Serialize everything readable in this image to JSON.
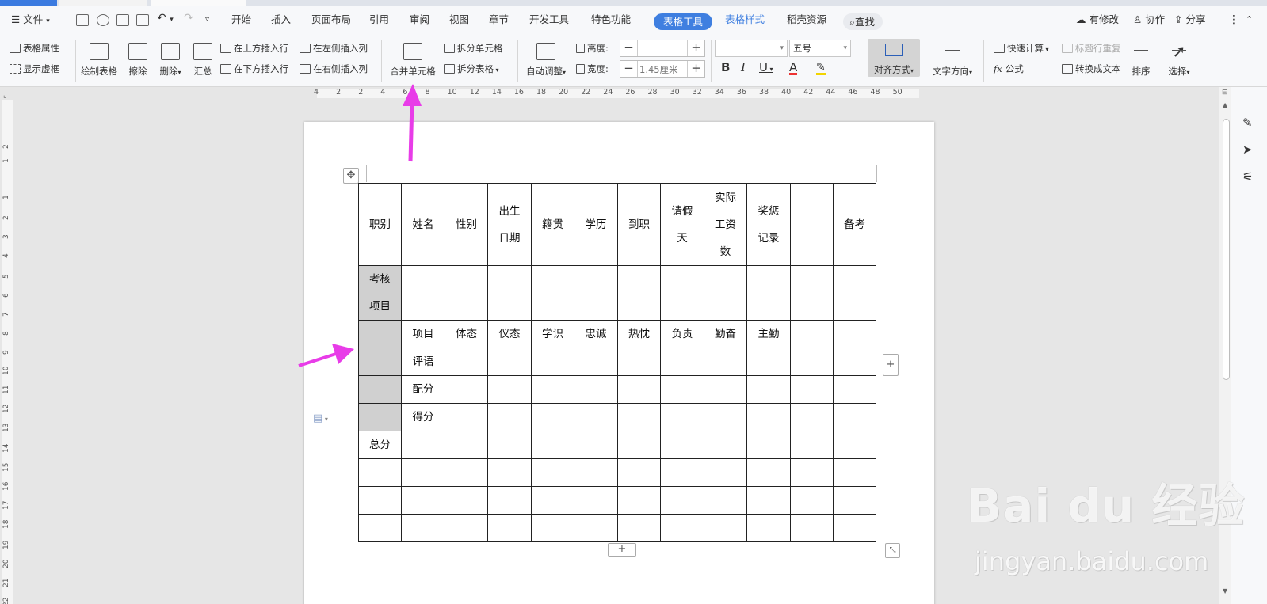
{
  "menubar": {
    "file": "文件",
    "tabs": [
      "开始",
      "插入",
      "页面布局",
      "引用",
      "审阅",
      "视图",
      "章节",
      "开发工具",
      "特色功能"
    ],
    "table_tools": "表格工具",
    "table_style": "表格样式",
    "shell_resources": "稻壳资源",
    "search": "查找",
    "has_changes": "有修改",
    "collab": "协作",
    "share": "分享"
  },
  "ribbon": {
    "table_props": "表格属性",
    "show_gridlines": "显示虚框",
    "draw_table": "绘制表格",
    "erase": "擦除",
    "delete": "删除",
    "summary": "汇总",
    "insert_above": "在上方插入行",
    "insert_below": "在下方插入行",
    "insert_left": "在左侧插入列",
    "insert_right": "在右侧插入列",
    "merge_cells": "合并单元格",
    "split_cells": "拆分单元格",
    "split_table": "拆分表格",
    "autofit": "自动调整",
    "height_label": "高度:",
    "width_label": "宽度:",
    "width_value": "1.45厘米",
    "font_size": "五号",
    "align": "对齐方式",
    "text_dir": "文字方向",
    "quick_calc": "快速计算",
    "repeat_header": "标题行重复",
    "formula": "公式",
    "to_text": "转换成文本",
    "sort": "排序",
    "select": "选择",
    "bold": "B",
    "italic": "I",
    "underline": "U",
    "font_color": "A"
  },
  "ruler": {
    "h": [
      "4",
      "2",
      "2",
      "4",
      "6",
      "8",
      "10",
      "12",
      "14",
      "16",
      "18",
      "20",
      "22",
      "24",
      "26",
      "28",
      "30",
      "32",
      "34",
      "36",
      "38",
      "40",
      "42",
      "44",
      "46",
      "48",
      "50"
    ],
    "v": [
      "2",
      "1",
      "1",
      "2",
      "3",
      "4",
      "5",
      "6",
      "7",
      "8",
      "9",
      "10",
      "11",
      "12",
      "13",
      "14",
      "15",
      "16",
      "17",
      "18",
      "19",
      "20",
      "21",
      "22",
      "23"
    ]
  },
  "table": {
    "header": [
      "职别",
      "姓名",
      "性别",
      "出生\n日期",
      "籍贯",
      "学历",
      "到职",
      "请假\n天",
      "实际\n工资\n数",
      "奖惩\n记录",
      "",
      "备考"
    ],
    "kaohe": "考核\n项目",
    "row_items": [
      "项目",
      "体态",
      "仪态",
      "学识",
      "忠诚",
      "热忱",
      "负责",
      "勤奋",
      "主勤"
    ],
    "pingyu": "评语",
    "peifen": "配分",
    "defen": "得分",
    "total": "总分"
  },
  "watermark": {
    "logo": "Bai du 经验",
    "url": "jingyan.baidu.com"
  },
  "colors": {
    "accent": "#3f7fe0",
    "arrow": "#e83ce8",
    "gray_cell": "#d0d0d0"
  }
}
